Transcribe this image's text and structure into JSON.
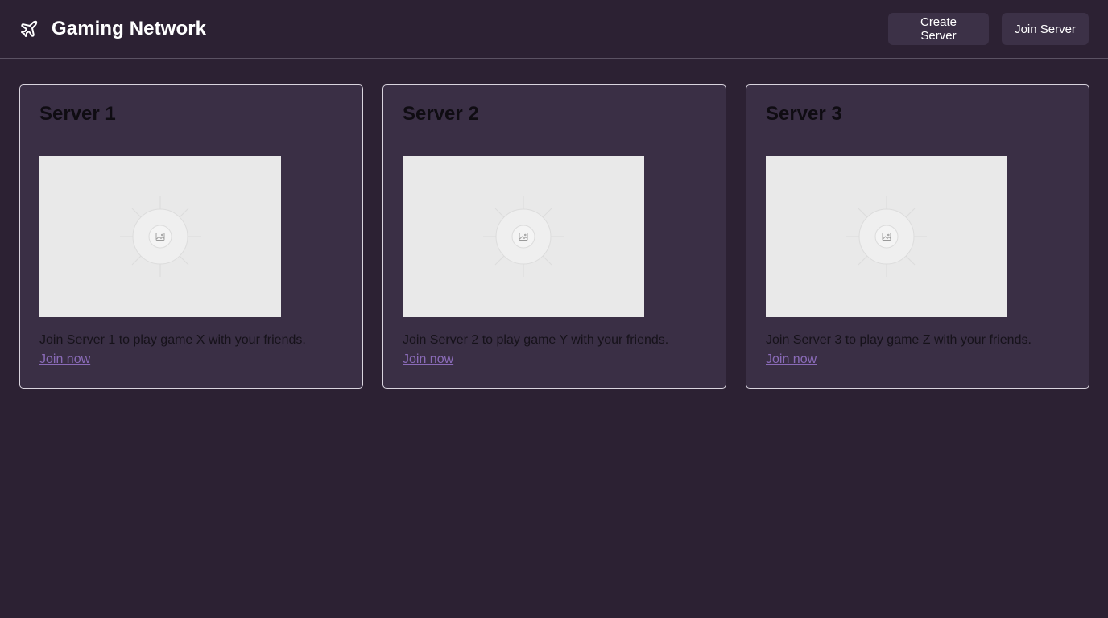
{
  "header": {
    "brand_icon": "airplane-icon",
    "title": "Gaming Network",
    "actions": {
      "create_label": "Create Server",
      "join_label": "Join Server"
    }
  },
  "servers": [
    {
      "title": "Server 1",
      "image_icon": "image-placeholder-icon",
      "description": "Join Server 1 to play game X with your friends.",
      "link_label": "Join now"
    },
    {
      "title": "Server 2",
      "image_icon": "image-placeholder-icon",
      "description": "Join Server 2 to play game Y with your friends.",
      "link_label": "Join now"
    },
    {
      "title": "Server 3",
      "image_icon": "image-placeholder-icon",
      "description": "Join Server 3 to play game Z with your friends.",
      "link_label": "Join now"
    }
  ],
  "colors": {
    "background": "#2c2133",
    "card_background": "#3a2f45",
    "button_background": "#3c3147",
    "link": "#8a6bb8",
    "image_placeholder": "#e9e9e9"
  }
}
